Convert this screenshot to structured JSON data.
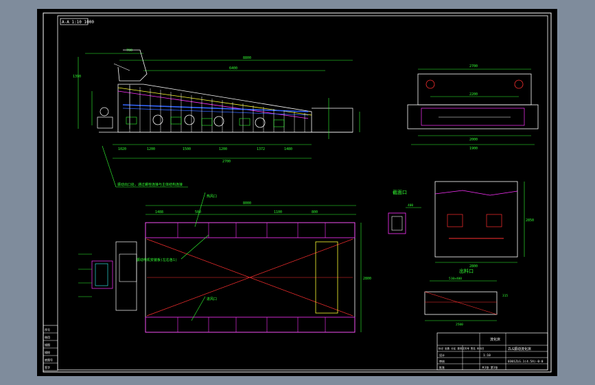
{
  "drawing": {
    "view_label": "A-A 1:10 1000",
    "section_a": "截面口",
    "section_b": "出料口",
    "dims": {
      "side_total_top": "8800",
      "side_mid": "6400",
      "side_left_up": "1390",
      "side_left_top": "700",
      "side_bottom_total": "2700",
      "side_b1": "1020",
      "side_b2": "1200",
      "side_b3": "1500",
      "side_b4": "1200",
      "side_b5": "1372",
      "side_b6": "1480",
      "plan_total": "8000",
      "plan_seg_a": "1488",
      "plan_seg_b": "500",
      "plan_seg_c": "1100",
      "plan_seg_d": "800",
      "plan_height": "2800",
      "end_top": "2700",
      "end_inner": "2200",
      "end_bottom": "2000",
      "end_bottom2": "1900",
      "back_width": "2800",
      "back_height": "2850",
      "outlet_top": "510x400",
      "outlet_side": "400",
      "outlet_width": "2500",
      "outlet_right": "315"
    },
    "notes": {
      "left_note": "振动出口处，通过螺栓连接与主体结构连接",
      "plan_note_a": "热风口",
      "plan_note_b": "振动电机安装板(左右各1)",
      "plan_note_c": "进风口"
    }
  },
  "titleblock": {
    "title": "流化床",
    "subtitle": "ZLG振动流化床",
    "drawing_no": "0301ZLG.1(4.5A)-0-0",
    "scale": "1:10",
    "sheet": "共1张 第1张",
    "designer": "设计",
    "checker": "审核",
    "approver": "批准",
    "sign_row": "标记 处数 分区 更改文件号 签名 年月日"
  },
  "revision_block": {
    "rows": [
      "序号",
      "借用",
      "描图",
      "描校",
      "底图号",
      "签字"
    ]
  },
  "colors": {
    "background": "#000000",
    "frame": "#ffffff",
    "dims": "#33ff33",
    "magenta": "#ff33ff",
    "red": "#ff3030",
    "blue": "#3366ff",
    "yellow": "#ffff33",
    "cyan": "#33ffff"
  }
}
